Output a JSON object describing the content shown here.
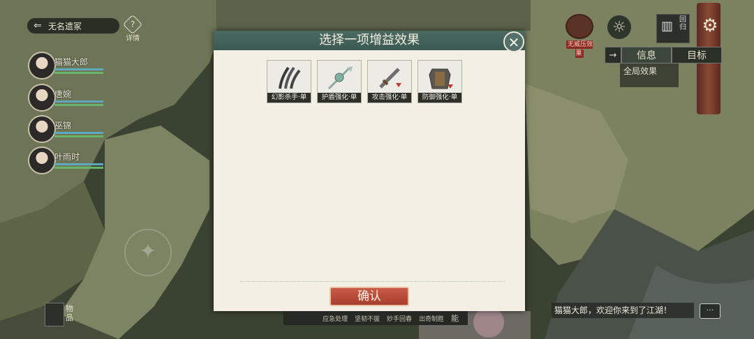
{
  "location": {
    "back_icon": "arrow-left-icon",
    "name": "无名遗冢"
  },
  "help": {
    "label": "详情",
    "icon": "question-icon"
  },
  "party": [
    {
      "name": "猫猫大郎"
    },
    {
      "name": "唐婉"
    },
    {
      "name": "巫锦"
    },
    {
      "name": "叶雨时"
    }
  ],
  "top_right": {
    "boss_label": "无威压效果",
    "back_label_1": "回",
    "back_label_2": "归",
    "tab_arrow": "→",
    "tabs": [
      "信息",
      "目标"
    ],
    "global_effects": "全局效果"
  },
  "dialog": {
    "title": "选择一项增益效果",
    "close_icon": "close-icon",
    "cards": [
      {
        "label": "幻影杀手·单",
        "icon": "claw-blades-icon"
      },
      {
        "label": "护盾强化·单",
        "icon": "shield-sword-icon"
      },
      {
        "label": "攻击强化·单",
        "icon": "sword-icon"
      },
      {
        "label": "防御强化·单",
        "icon": "armor-icon"
      }
    ],
    "confirm_label": "确认"
  },
  "bottom": {
    "bag_label_1": "物",
    "bag_label_2": "品",
    "skills": [
      "应急处理",
      "坚韧不拔",
      "妙手回春",
      "出奇制胜"
    ],
    "skill_tail": "能",
    "chat_message": "猫猫大郎，欢迎你来到了江湖！",
    "chat_icon": "chat-bubble-icon"
  },
  "colors": {
    "dialog_header": "#45645c",
    "confirm": "#b84b3a",
    "map_dark": "#3c4533"
  }
}
